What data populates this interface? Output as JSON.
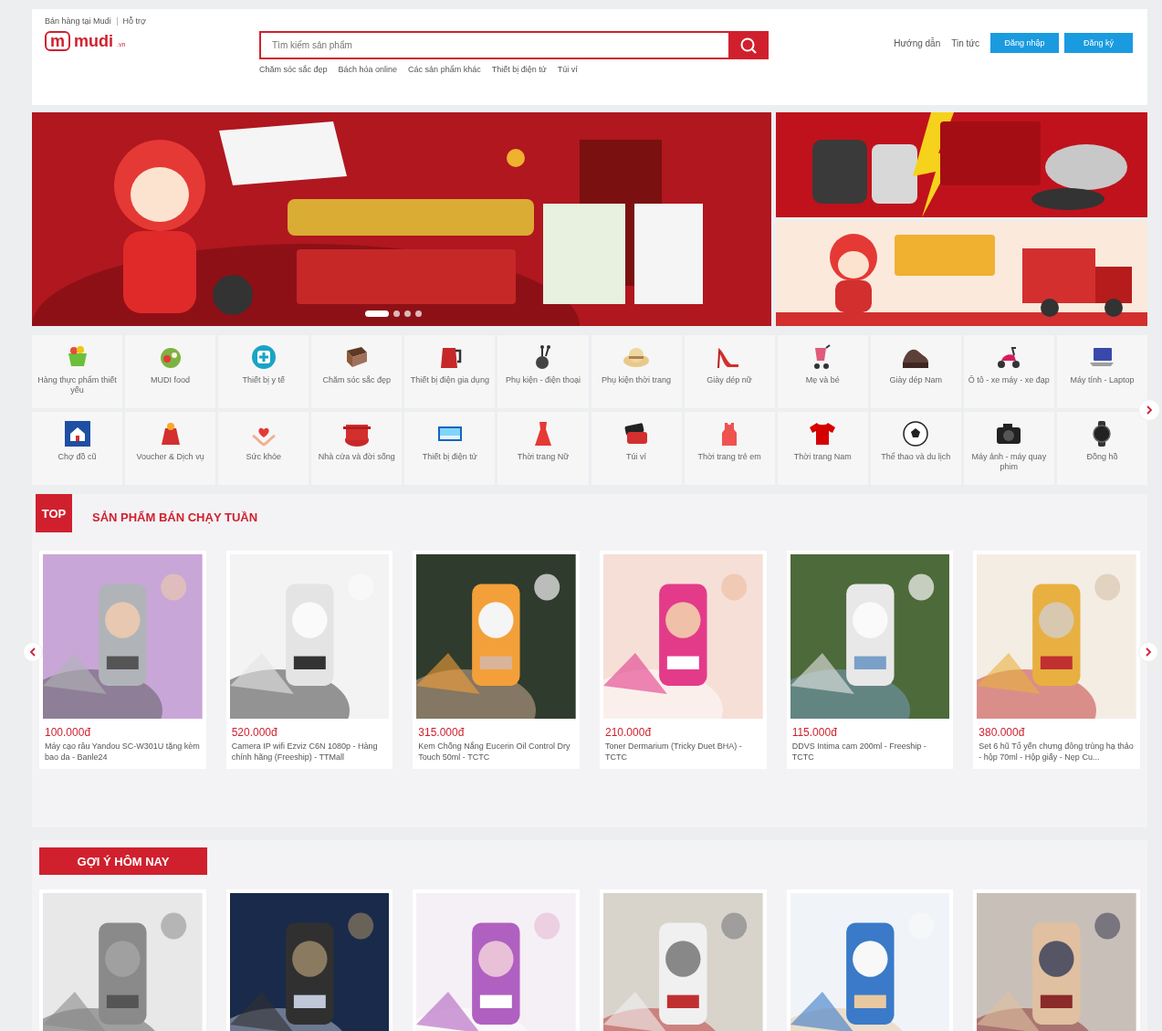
{
  "top_links": [
    "Bán hàng tại Mudi",
    "Hỗ trợ"
  ],
  "logo": {
    "mark": "m",
    "name": "mudi",
    "suffix": ".vn"
  },
  "search": {
    "placeholder": "Tìm kiếm sản phẩm"
  },
  "quick_links": [
    "Chăm sóc sắc đẹp",
    "Bách hóa online",
    "Các sản phẩm khác",
    "Thiết bị điện tử",
    "Túi ví"
  ],
  "nav_links": [
    "Hướng dẫn",
    "Tin tức"
  ],
  "auth_buttons": [
    "Đăng nhập",
    "Đăng ký"
  ],
  "banner_dots": [
    {
      "selected": true
    },
    {
      "selected": false
    },
    {
      "selected": false
    },
    {
      "selected": false
    }
  ],
  "categories": [
    {
      "label": "Hàng thực phẩm thiết yếu"
    },
    {
      "label": "MUDI food"
    },
    {
      "label": "Thiết bị y tế"
    },
    {
      "label": "Chăm sóc sắc đẹp"
    },
    {
      "label": "Thiết bị điện gia dụng"
    },
    {
      "label": "Phụ kiện - điện thoại"
    },
    {
      "label": "Phụ kiện thời trang"
    },
    {
      "label": "Giày dép nữ"
    },
    {
      "label": "Mẹ và bé"
    },
    {
      "label": "Giày dép Nam"
    },
    {
      "label": "Ô tô - xe máy - xe đạp"
    },
    {
      "label": "Máy tính - Laptop"
    },
    {
      "label": "Chợ đồ cũ"
    },
    {
      "label": "Voucher & Dịch vụ"
    },
    {
      "label": "Sức khỏe"
    },
    {
      "label": "Nhà cửa và đời sống"
    },
    {
      "label": "Thiết bị điện tử"
    },
    {
      "label": "Thời trang Nữ"
    },
    {
      "label": "Túi ví"
    },
    {
      "label": "Thời trang trẻ em"
    },
    {
      "label": "Thời trang Nam"
    },
    {
      "label": "Thể thao và du lịch"
    },
    {
      "label": "Máy ảnh - máy quay phim"
    },
    {
      "label": "Đồng hồ"
    }
  ],
  "top_section": {
    "badge": "TOP",
    "title": "SẢN PHẨM BÁN CHẠY TUẦN",
    "products": [
      {
        "price": "100.000đ",
        "name": "Máy cạo râu Yandou SC-W301U tặng kèm bao da - Banle24"
      },
      {
        "price": "520.000đ",
        "name": "Camera IP wifi Ezviz C6N 1080p - Hàng chính hãng (Freeship) - TTMall"
      },
      {
        "price": "315.000đ",
        "name": "Kem Chống Nắng Eucerin Oil Control Dry Touch 50ml - TCTC"
      },
      {
        "price": "210.000đ",
        "name": "Toner Dermarium (Tricky Duet BHA) - TCTC"
      },
      {
        "price": "115.000đ",
        "name": "DDVS Intima cam 200ml - Freeship - TCTC"
      },
      {
        "price": "380.000đ",
        "name": "Set 6 hũ Tổ yến chưng đông trùng hạ thảo - hộp 70ml - Hộp giấy - Nẹp Cu..."
      }
    ]
  },
  "suggest_section": {
    "title": "GỢI Ý HÔM NAY"
  }
}
